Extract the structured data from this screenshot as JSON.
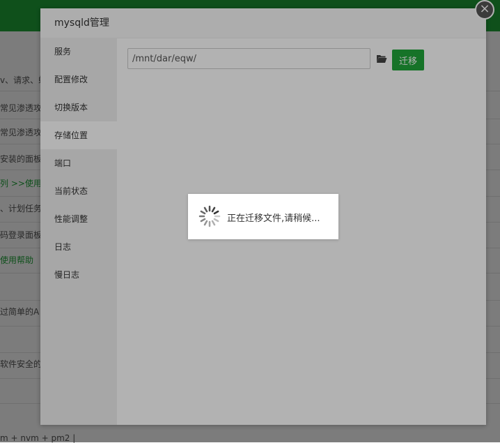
{
  "background": {
    "rows": [
      {
        "text": "v、请求、蜘",
        "green": false
      },
      {
        "text": "常见渗透攻",
        "green": false
      },
      {
        "text": "常见渗透攻",
        "green": false
      },
      {
        "text": "安装的面板,",
        "green": false
      },
      {
        "text": "列 >>使用帮",
        "green": true
      },
      {
        "text": "、计划任务",
        "green": false
      },
      {
        "text": "码登录面板",
        "green": false
      },
      {
        "text": "使用帮助",
        "green": true
      },
      {
        "text": "过简单的A",
        "green": false
      },
      {
        "text": "软件安全的",
        "green": false
      },
      {
        "text": "m + nvm + pm2 |",
        "green": false
      }
    ]
  },
  "dialog": {
    "title": "mysqld管理",
    "close_glyph": "×",
    "sidebar": [
      {
        "label": "服务"
      },
      {
        "label": "配置修改"
      },
      {
        "label": "切换版本"
      },
      {
        "label": "存储位置",
        "active": true
      },
      {
        "label": "端口"
      },
      {
        "label": "当前状态"
      },
      {
        "label": "性能调整"
      },
      {
        "label": "日志"
      },
      {
        "label": "慢日志"
      }
    ],
    "path_value": "/mnt/dar/eqw/",
    "migrate_label": "迁移"
  },
  "loading": {
    "message": "正在迁移文件,请稍候..."
  },
  "colors": {
    "accent": "#20a53a"
  }
}
